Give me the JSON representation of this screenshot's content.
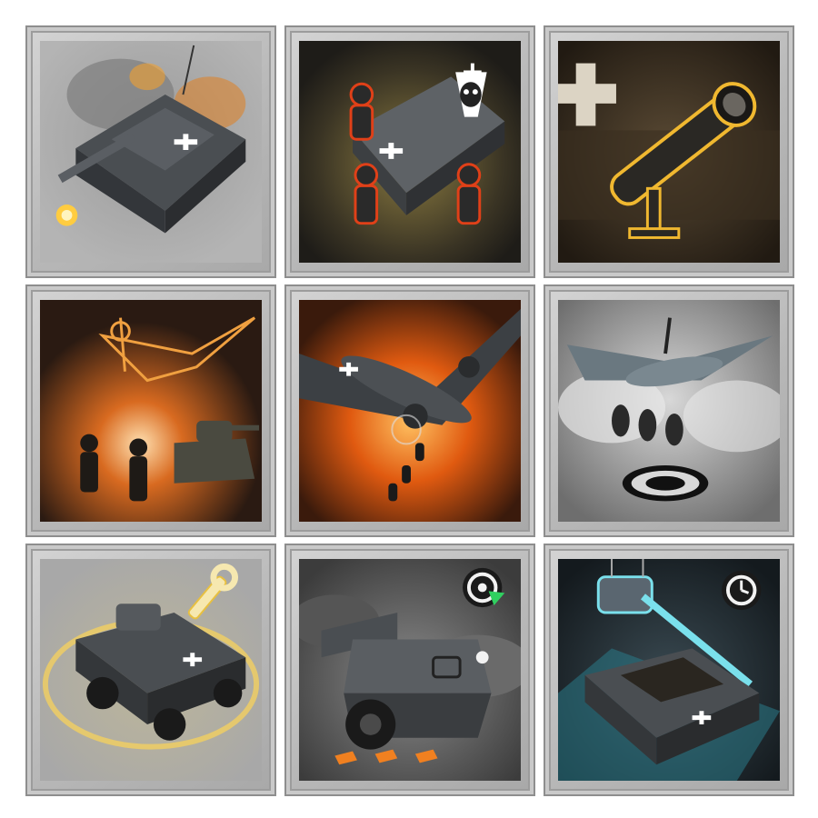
{
  "panel": {
    "background": "#ffffff",
    "tile_frame": "#b8b8b8"
  },
  "abilities": [
    {
      "icon": "assault-gun-barrage-icon",
      "accent": "#f0a020"
    },
    {
      "icon": "infantry-halftrack-icon",
      "accent": "#e05018",
      "badge_icon": "skull-crest-badge-icon"
    },
    {
      "icon": "panzerschreck-launcher-icon",
      "accent": "#f0b830"
    },
    {
      "icon": "ju87-strafing-run-icon",
      "accent": "#f08828"
    },
    {
      "icon": "bomber-carpet-bombing-icon",
      "accent": "#ff7a10"
    },
    {
      "icon": "stuka-dive-bomb-icon",
      "accent": "#2a2a2a"
    },
    {
      "icon": "armored-car-repair-icon",
      "accent": "#e8c040",
      "badge_icon": "wrench-icon"
    },
    {
      "icon": "halftrack-recall-icon",
      "accent": "#30d060",
      "badge_icon": "recall-radar-icon"
    },
    {
      "icon": "tank-airdrop-icon",
      "accent": "#40c8d8",
      "badge_icon": "clock-timer-icon"
    }
  ]
}
